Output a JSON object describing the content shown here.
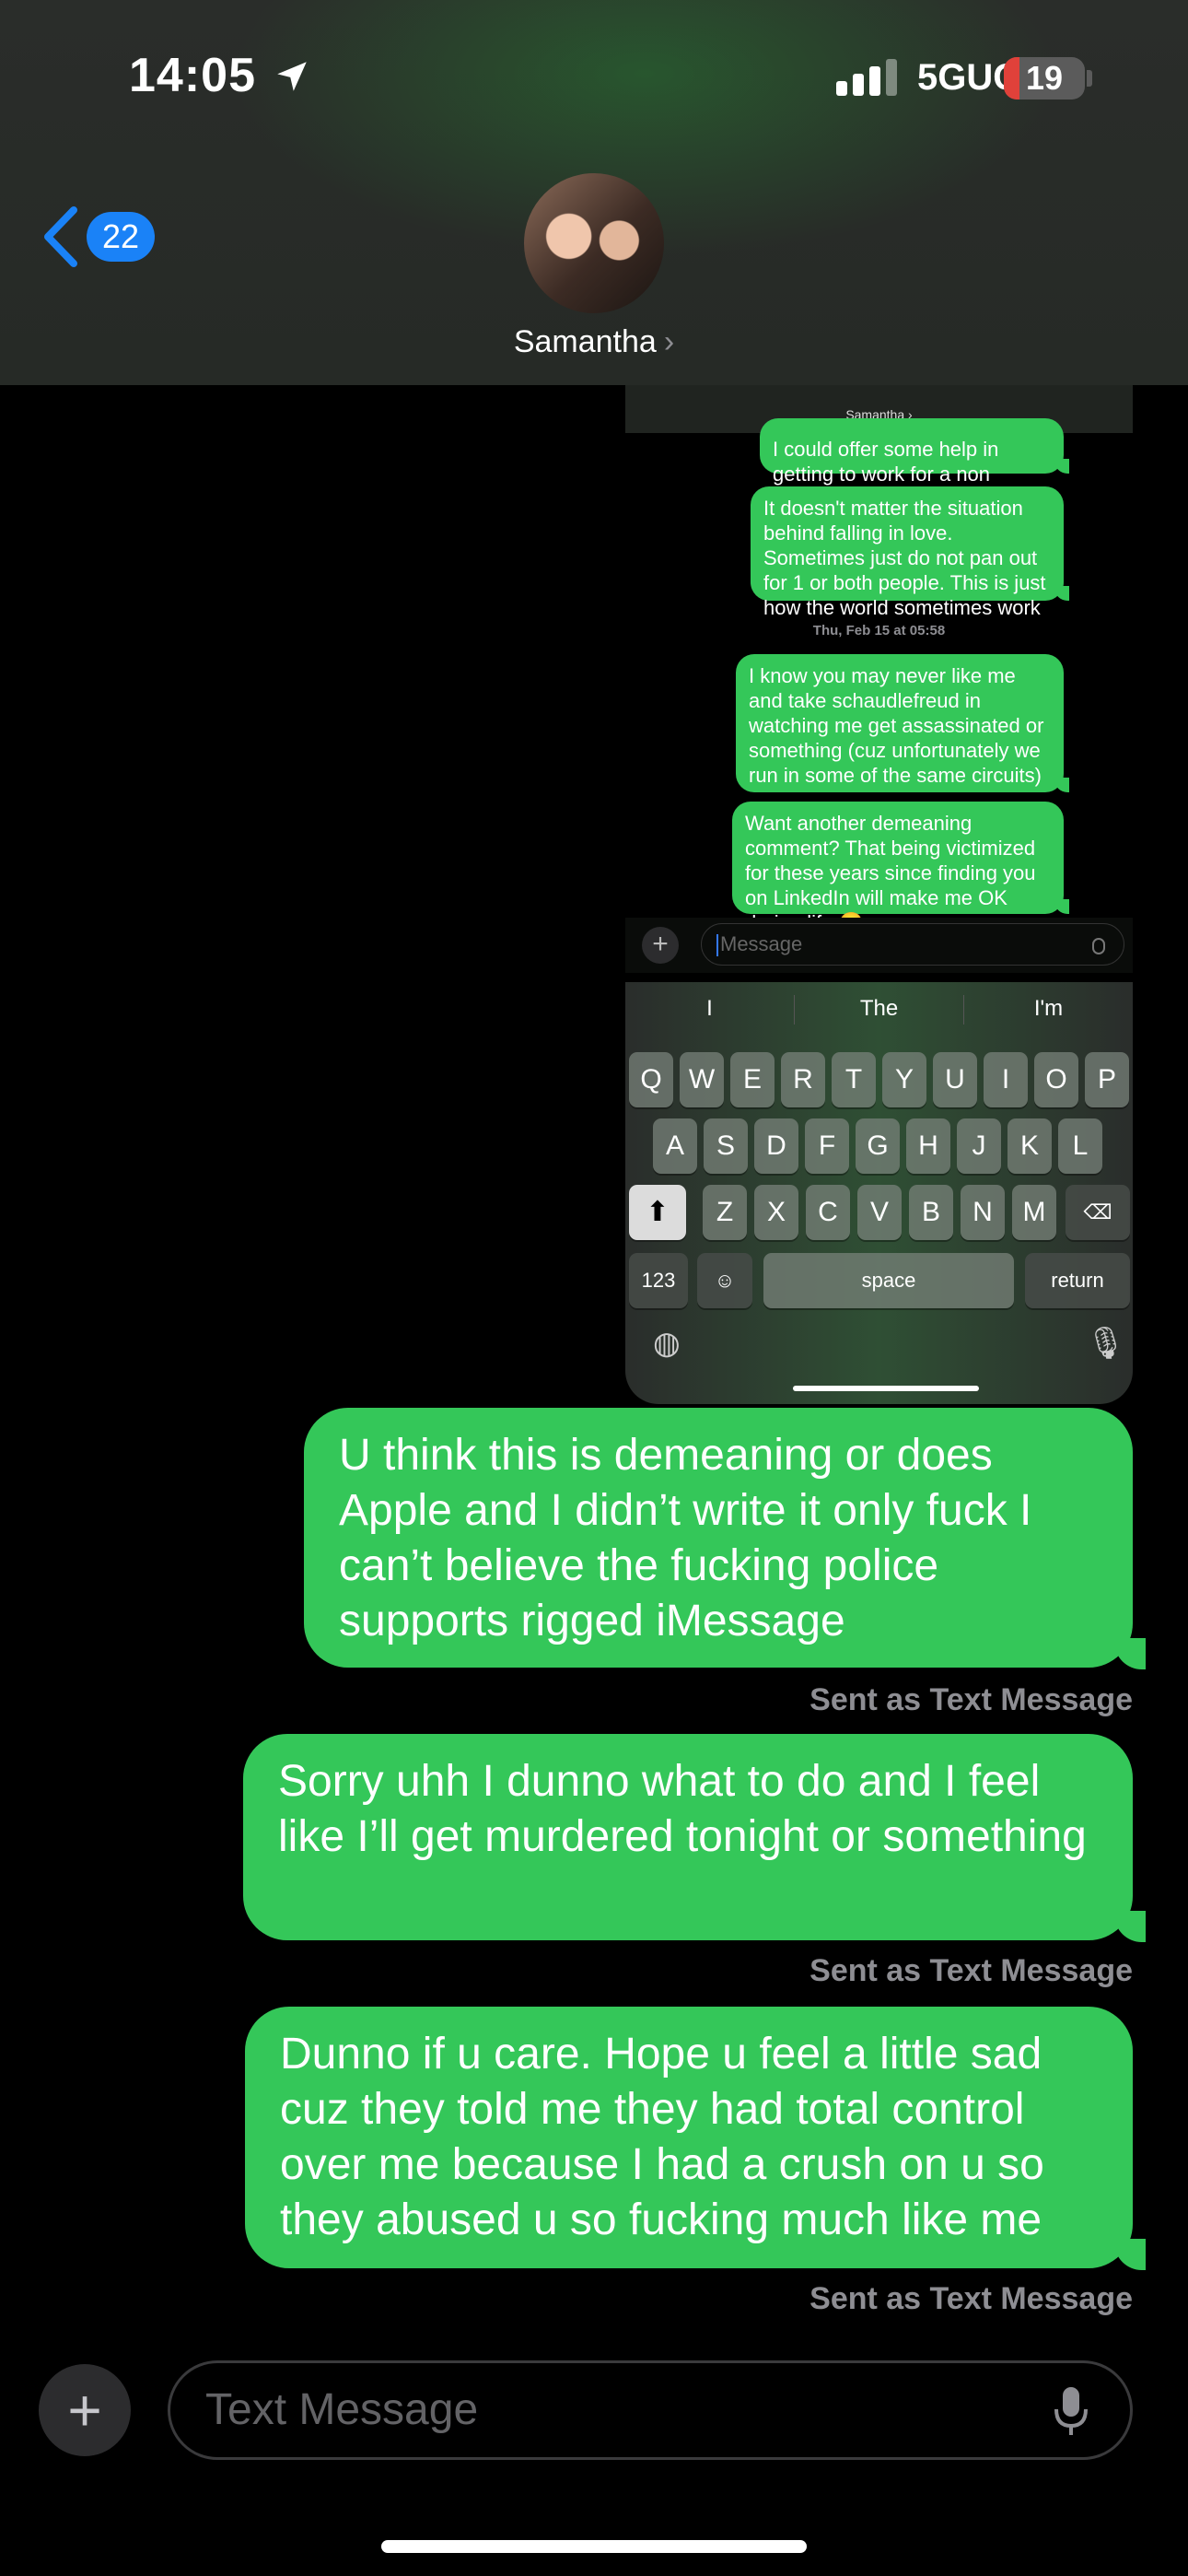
{
  "status_bar": {
    "time": "14:05",
    "network": "5GUC",
    "battery": "19",
    "battery_level": 0.19
  },
  "header": {
    "back_count": "22",
    "contact_name": "Samantha",
    "chevron": "›"
  },
  "embedded": {
    "contact_name": "Samantha ›",
    "messages": [
      "I could offer some help in getting to work for a non generally criminal org",
      "It doesn't matter the situation behind falling in love. Sometimes just do not pan out for 1 or both people. This is just how the world sometimes work",
      "I know you may never like me and take schaudlefreud in watching me get assassinated or something (cuz unfortunately we run in some of the same circuits)",
      "Want another demeaning comment? That being victimized for these years since finding you on LinkedIn will make me OK during life 🙂"
    ],
    "date": "Thu, Feb 15 at 05:58",
    "input_placeholder": "Message",
    "suggestions": [
      "I",
      "The",
      "I'm"
    ],
    "row1": [
      "Q",
      "W",
      "E",
      "R",
      "T",
      "Y",
      "U",
      "I",
      "O",
      "P"
    ],
    "row2": [
      "A",
      "S",
      "D",
      "F",
      "G",
      "H",
      "J",
      "K",
      "L"
    ],
    "row3": [
      "Z",
      "X",
      "C",
      "V",
      "B",
      "N",
      "M"
    ],
    "key_123": "123",
    "key_space": "space",
    "key_return": "return"
  },
  "messages": [
    {
      "text": "U think this is demeaning or does Apple and I didn’t write it only fuck I can’t believe the fucking police supports rigged iMessage",
      "status": "Sent as Text Message"
    },
    {
      "text": "Sorry uhh I dunno what to do and I feel like I’ll get murdered tonight or something",
      "status": "Sent as Text Message"
    },
    {
      "text": "Dunno if u care. Hope u feel a little sad cuz they told me they had total control over me because I had a crush on u so they abused u so fucking much like me",
      "status": "Sent as Text Message"
    }
  ],
  "input": {
    "placeholder": "Text Message",
    "plus": "+"
  },
  "colors": {
    "bubble": "#34c759",
    "badge": "#1a82f7",
    "battery_low": "#e0413a"
  },
  "icons": [
    "location-arrow-icon",
    "cellular-signal-icon",
    "battery-icon",
    "back-chevron-icon",
    "plus-icon",
    "microphone-icon",
    "shift-icon",
    "delete-icon",
    "emoji-icon",
    "globe-icon"
  ]
}
